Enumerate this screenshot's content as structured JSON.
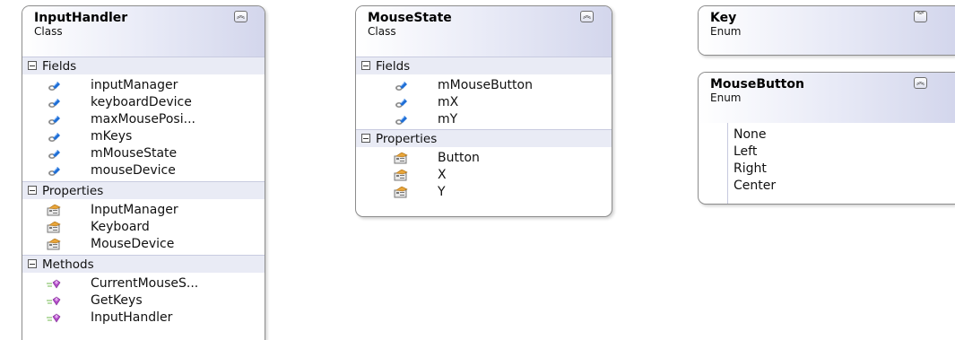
{
  "inputHandler": {
    "name": "InputHandler",
    "kind": "Class",
    "collapse_glyph": "︽",
    "sections": {
      "fields": {
        "title": "Fields",
        "items": [
          "inputManager",
          "keyboardDevice",
          "maxMousePosi...",
          "mKeys",
          "mMouseState",
          "mouseDevice"
        ]
      },
      "properties": {
        "title": "Properties",
        "items": [
          "InputManager",
          "Keyboard",
          "MouseDevice"
        ]
      },
      "methods": {
        "title": "Methods",
        "items": [
          "CurrentMouseS...",
          "GetKeys",
          "InputHandler"
        ]
      }
    }
  },
  "mouseState": {
    "name": "MouseState",
    "kind": "Class",
    "collapse_glyph": "︽",
    "sections": {
      "fields": {
        "title": "Fields",
        "items": [
          "mMouseButton",
          "mX",
          "mY"
        ]
      },
      "properties": {
        "title": "Properties",
        "items": [
          "Button",
          "X",
          "Y"
        ]
      }
    }
  },
  "key": {
    "name": "Key",
    "kind": "Enum",
    "collapse_glyph": "︾"
  },
  "mouseButton": {
    "name": "MouseButton",
    "kind": "Enum",
    "collapse_glyph": "︽",
    "values": [
      "None",
      "Left",
      "Right",
      "Center"
    ]
  },
  "icons": {
    "field": "field-icon",
    "property": "property-icon",
    "method": "method-icon"
  },
  "colors": {
    "header_gradient_start": "#ffffff",
    "header_gradient_end": "#d3d6ec",
    "section_bg": "#e9ebf5",
    "border": "#8c8c8c"
  }
}
